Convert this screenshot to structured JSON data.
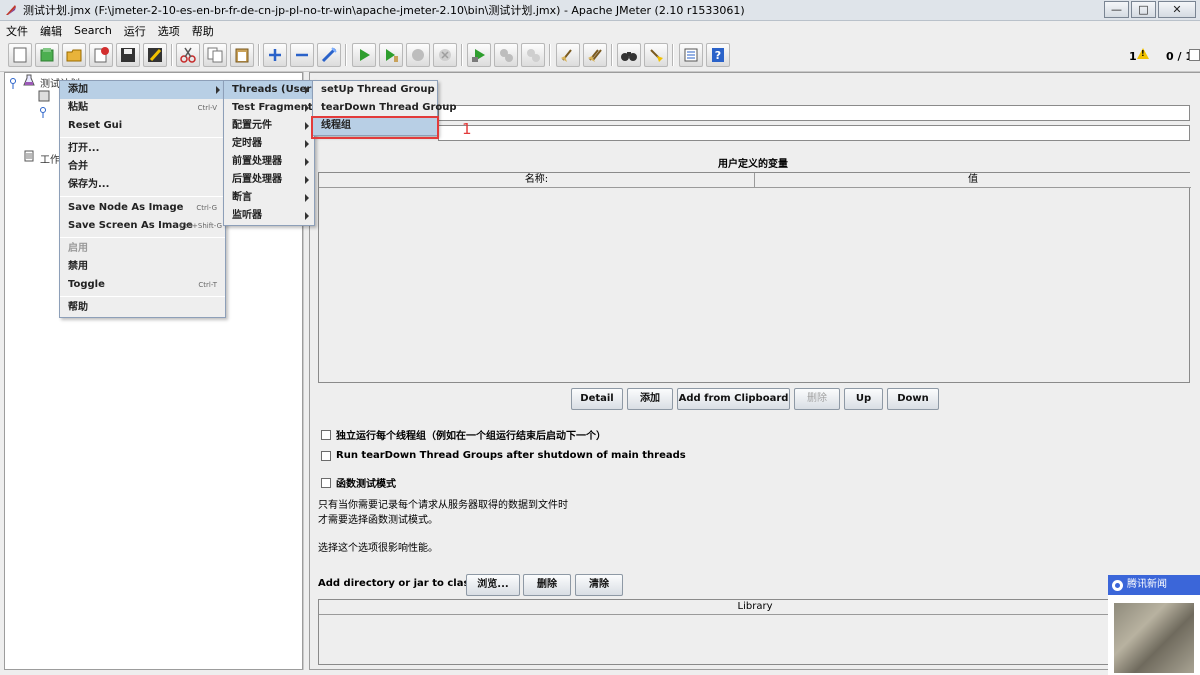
{
  "window": {
    "title": "测试计划.jmx (F:\\jmeter-2-10-es-en-br-fr-de-cn-jp-pl-no-tr-win\\apache-jmeter-2.10\\bin\\测试计划.jmx) - Apache JMeter (2.10 r1533061)",
    "min": "—",
    "max": "□",
    "close": "✕"
  },
  "menubar": [
    "文件",
    "编辑",
    "Search",
    "运行",
    "选项",
    "帮助"
  ],
  "toolbar": {
    "warnings": "1",
    "threads": "0 / 1"
  },
  "tree": {
    "root": "测试计划",
    "workbench": "工作台"
  },
  "context_menu": {
    "items": [
      {
        "label": "添加",
        "submenu": true
      },
      {
        "label": "粘贴",
        "accel": "Ctrl-V"
      },
      {
        "label": "Reset Gui"
      },
      {
        "label": "打开..."
      },
      {
        "label": "合并"
      },
      {
        "label": "保存为..."
      },
      {
        "label": "Save Node As Image",
        "accel": "Ctrl-G"
      },
      {
        "label": "Save Screen As Image",
        "accel": "Ctrl+Shift-G"
      },
      {
        "label": "启用"
      },
      {
        "label": "禁用"
      },
      {
        "label": "Toggle",
        "accel": "Ctrl-T"
      },
      {
        "label": "帮助"
      }
    ]
  },
  "add_submenu": {
    "items": [
      "Threads (Users)",
      "Test Fragment",
      "配置元件",
      "定时器",
      "前置处理器",
      "后置处理器",
      "断言",
      "监听器"
    ]
  },
  "threads_submenu": {
    "items": [
      "setUp Thread Group",
      "tearDown Thread Group",
      "线程组"
    ]
  },
  "annotation": {
    "number": "1",
    "color": "#e23b3b"
  },
  "panel": {
    "user_vars_title": "用户定义的变量",
    "col_name": "名称:",
    "col_value": "值",
    "buttons": [
      "Detail",
      "添加",
      "Add from Clipboard",
      "删除",
      "Up",
      "Down"
    ],
    "check_independent": "独立运行每个线程组（例如在一个组运行结束后启动下一个）",
    "check_teardown": "Run tearDown Thread Groups after shutdown of main threads",
    "check_functional": "函数测试模式",
    "note_line1": "只有当你需要记录每个请求从服务器取得的数据到文件时",
    "note_line2": "才需要选择函数测试模式。",
    "note_line3": "选择这个选项很影响性能。",
    "classpath_label": "Add directory or jar to classpath",
    "classpath_buttons": [
      "浏览...",
      "删除",
      "清除"
    ],
    "library_header": "Library"
  },
  "news_widget": {
    "title": "腾讯新闻",
    "color": "#3b66d9"
  }
}
